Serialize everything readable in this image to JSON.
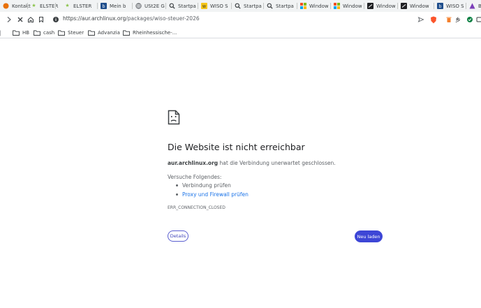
{
  "tabs": [
    {
      "title": "Kontakt",
      "icon": "circle-app-icon",
      "color": "#e8710a"
    },
    {
      "title": "ELSTER",
      "icon": "star-icon",
      "color": "#8bc34a"
    },
    {
      "title": "ELSTER",
      "icon": "star-icon",
      "color": "#8bc34a"
    },
    {
      "title": "Mein b",
      "icon": "bank-icon",
      "color": "#1f4e8c"
    },
    {
      "title": "USt2E G",
      "icon": "globe-icon",
      "color": "#5f6368"
    },
    {
      "title": "Startpa",
      "icon": "search-icon",
      "color": "#3c4043"
    },
    {
      "title": "WISO S",
      "icon": "wiso-icon",
      "color": "#f5c518"
    },
    {
      "title": "Startpa",
      "icon": "search-icon",
      "color": "#3c4043"
    },
    {
      "title": "Startpa",
      "icon": "search-icon",
      "color": "#3c4043"
    },
    {
      "title": "Window",
      "icon": "windows-icon",
      "color": "#f25022"
    },
    {
      "title": "Window",
      "icon": "windows-icon",
      "color": "#f25022"
    },
    {
      "title": "Window",
      "icon": "terminal-icon",
      "color": "#202124"
    },
    {
      "title": "Window",
      "icon": "terminal-icon",
      "color": "#202124"
    },
    {
      "title": "WISO S",
      "icon": "bank-icon",
      "color": "#1f4e8c"
    },
    {
      "title": "B",
      "icon": "arch-icon",
      "color": "#7b3fb8"
    }
  ],
  "toolbar": {
    "url_host": "https://aur.archlinux.org",
    "url_path": "/packages/wiso-steuer-2026"
  },
  "bookmarks": [
    {
      "label": "HB"
    },
    {
      "label": "cash"
    },
    {
      "label": "Steuer"
    },
    {
      "label": "Advanzia"
    },
    {
      "label": "Rheinhessische-..."
    }
  ],
  "error": {
    "title": "Die Website ist nicht erreichbar",
    "host": "aur.archlinux.org",
    "desc_rest": " hat die Verbindung unerwartet geschlossen.",
    "try_label": "Versuche Folgendes:",
    "suggestions": [
      "Verbindung prüfen",
      "Proxy und Firewall prüfen"
    ],
    "code": "ERR_CONNECTION_CLOSED",
    "details_label": "Details",
    "reload_label": "Neu laden"
  },
  "colors": {
    "accent": "#3d46d6",
    "link": "#1a73e8"
  }
}
